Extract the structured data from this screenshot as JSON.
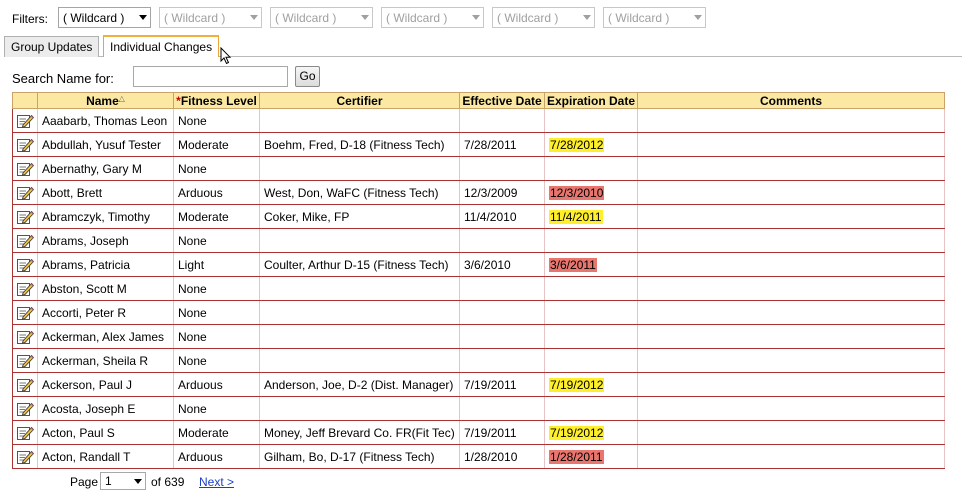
{
  "filters": {
    "label": "Filters:",
    "primary": "( Wildcard )",
    "others": [
      "( Wildcard )",
      "( Wildcard )",
      "( Wildcard )",
      "( Wildcard )",
      "( Wildcard )"
    ]
  },
  "tabs": [
    {
      "label": "Group Updates",
      "active": false
    },
    {
      "label": "Individual Changes",
      "active": true
    }
  ],
  "search": {
    "label": "Search Name for:",
    "value": "",
    "button": "Go"
  },
  "columns": {
    "name": "Name",
    "fitness_req": "*",
    "fitness": "Fitness Level",
    "certifier": "Certifier",
    "effective": "Effective Date",
    "expiration": "Expiration Date",
    "comments": "Comments"
  },
  "rows": [
    {
      "name": "Aaabarb, Thomas Leon",
      "fitness": "None",
      "certifier": "",
      "effective": "",
      "expiration": "",
      "exp_status": "",
      "comments": ""
    },
    {
      "name": "Abdullah, Yusuf Tester",
      "fitness": "Moderate",
      "certifier": "Boehm, Fred, D-18 (Fitness Tech)",
      "effective": "7/28/2011",
      "expiration": "7/28/2012",
      "exp_status": "yellow",
      "comments": ""
    },
    {
      "name": "Abernathy, Gary M",
      "fitness": "None",
      "certifier": "",
      "effective": "",
      "expiration": "",
      "exp_status": "",
      "comments": ""
    },
    {
      "name": "Abott, Brett",
      "fitness": "Arduous",
      "certifier": "West, Don, WaFC (Fitness Tech)",
      "effective": "12/3/2009",
      "expiration": "12/3/2010",
      "exp_status": "red",
      "comments": ""
    },
    {
      "name": "Abramczyk, Timothy",
      "fitness": "Moderate",
      "certifier": "Coker, Mike, FP",
      "effective": "11/4/2010",
      "expiration": "11/4/2011",
      "exp_status": "yellow",
      "comments": ""
    },
    {
      "name": "Abrams, Joseph",
      "fitness": "None",
      "certifier": "",
      "effective": "",
      "expiration": "",
      "exp_status": "",
      "comments": ""
    },
    {
      "name": "Abrams, Patricia",
      "fitness": "Light",
      "certifier": "Coulter, Arthur D-15 (Fitness Tech)",
      "effective": "3/6/2010",
      "expiration": "3/6/2011",
      "exp_status": "red",
      "comments": ""
    },
    {
      "name": "Abston, Scott M",
      "fitness": "None",
      "certifier": "",
      "effective": "",
      "expiration": "",
      "exp_status": "",
      "comments": ""
    },
    {
      "name": "Accorti, Peter R",
      "fitness": "None",
      "certifier": "",
      "effective": "",
      "expiration": "",
      "exp_status": "",
      "comments": ""
    },
    {
      "name": "Ackerman, Alex James",
      "fitness": "None",
      "certifier": "",
      "effective": "",
      "expiration": "",
      "exp_status": "",
      "comments": ""
    },
    {
      "name": "Ackerman, Sheila R",
      "fitness": "None",
      "certifier": "",
      "effective": "",
      "expiration": "",
      "exp_status": "",
      "comments": ""
    },
    {
      "name": "Ackerson, Paul J",
      "fitness": "Arduous",
      "certifier": "Anderson, Joe, D-2 (Dist. Manager)",
      "effective": "7/19/2011",
      "expiration": "7/19/2012",
      "exp_status": "yellow",
      "comments": ""
    },
    {
      "name": "Acosta, Joseph E",
      "fitness": "None",
      "certifier": "",
      "effective": "",
      "expiration": "",
      "exp_status": "",
      "comments": ""
    },
    {
      "name": "Acton, Paul S",
      "fitness": "Moderate",
      "certifier": "Money, Jeff Brevard Co. FR(Fit Tec)",
      "effective": "7/19/2011",
      "expiration": "7/19/2012",
      "exp_status": "yellow",
      "comments": ""
    },
    {
      "name": "Acton, Randall T",
      "fitness": "Arduous",
      "certifier": "Gilham, Bo, D-17 (Fitness Tech)",
      "effective": "1/28/2010",
      "expiration": "1/28/2011",
      "exp_status": "red",
      "comments": ""
    }
  ],
  "pager": {
    "label": "Page",
    "current": "1",
    "total_text": "of 639",
    "next": "Next >"
  },
  "colors": {
    "header_bg": "#fbe9a3",
    "row_border": "#aa3333",
    "highlight_yellow": "#ffef2a",
    "highlight_red": "#e8766e",
    "link": "#1a3fc4"
  },
  "icons": {
    "row_action": "edit-pencil-icon",
    "cursor": "mouse-pointer-icon"
  }
}
